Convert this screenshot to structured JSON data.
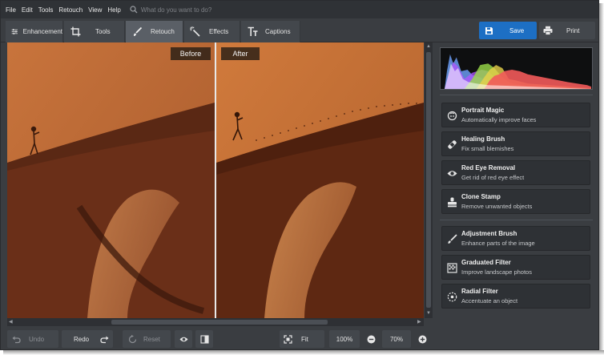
{
  "menu": [
    "File",
    "Edit",
    "Tools",
    "Retouch",
    "View",
    "Help"
  ],
  "search": {
    "placeholder": "What do you want to do?"
  },
  "tabs": [
    {
      "label": "Enhancement",
      "icon": "sliders-icon"
    },
    {
      "label": "Tools",
      "icon": "crop-icon"
    },
    {
      "label": "Retouch",
      "icon": "brush-icon",
      "active": true
    },
    {
      "label": "Effects",
      "icon": "magic-wand-icon"
    },
    {
      "label": "Captions",
      "icon": "text-icon"
    }
  ],
  "actions": {
    "save": "Save",
    "print": "Print"
  },
  "canvas": {
    "before_label": "Before",
    "after_label": "After"
  },
  "retouch_tools": [
    {
      "name": "Portrait Magic",
      "desc": "Automatically improve faces",
      "icon": "face-icon"
    },
    {
      "name": "Healing Brush",
      "desc": "Fix small blemishes",
      "icon": "bandage-icon"
    },
    {
      "name": "Red Eye Removal",
      "desc": "Get rid of red eye effect",
      "icon": "eye-icon"
    },
    {
      "name": "Clone Stamp",
      "desc": "Remove unwanted objects",
      "icon": "stamp-icon"
    },
    {
      "name": "Adjustment Brush",
      "desc": "Enhance parts of the image",
      "icon": "brush-icon"
    },
    {
      "name": "Graduated Filter",
      "desc": "Improve landscape photos",
      "icon": "gradient-icon"
    },
    {
      "name": "Radial Filter",
      "desc": "Accentuate an object",
      "icon": "radial-icon"
    }
  ],
  "bottom": {
    "undo": "Undo",
    "redo": "Redo",
    "reset": "Reset",
    "fit": "Fit",
    "zoom_100": "100%",
    "zoom_level": "70%"
  },
  "colors": {
    "accent": "#1d6fc4",
    "panel": "#3a3d41",
    "menubar": "#2f3236"
  }
}
